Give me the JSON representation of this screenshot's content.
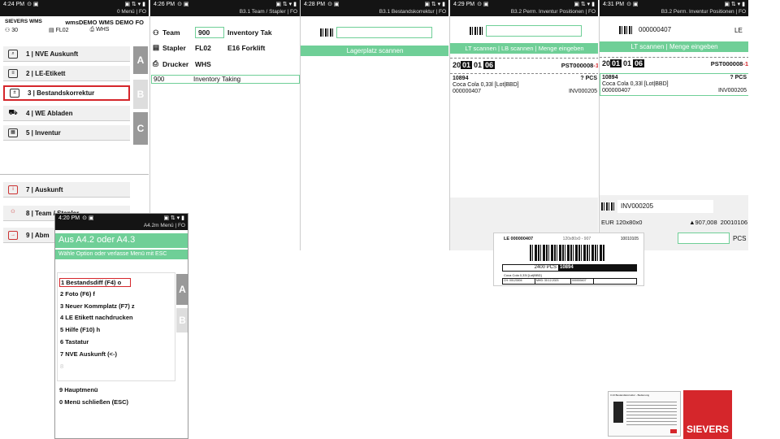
{
  "screens": {
    "main": {
      "time": "4:24 PM",
      "header": "0 Menü | FO",
      "brand": "SIEVERS WMS",
      "title": "wmsDEMO WMS DEMO FO",
      "team": "30",
      "stapler": "FL02",
      "printer": "WHS",
      "items": [
        {
          "icon": "doc-search-icon",
          "label": "1 | NVE Auskunft"
        },
        {
          "icon": "tag-icon",
          "label": "2 | LE-Etikett"
        },
        {
          "icon": "edit-list-icon",
          "label": "3 | Bestandskorrektur"
        },
        {
          "icon": "truck-icon",
          "label": "4 | WE Abladen"
        },
        {
          "icon": "grid-icon",
          "label": "5 | Inventur"
        }
      ],
      "items2": [
        {
          "icon": "info-icon",
          "label": "7 | Auskunft"
        },
        {
          "icon": "people-icon",
          "label": "8 | Team / Stapler"
        },
        {
          "icon": "logout-icon",
          "label": "9 | Abm"
        }
      ],
      "tabs": [
        "A",
        "B",
        "C"
      ]
    },
    "team": {
      "time": "4:26 PM",
      "header": "B3.1 Team / Stapler | FO",
      "team_label": "Team",
      "team_val": "900",
      "team_name": "Inventory Tak",
      "stapler_label": "Stapler",
      "stapler_val": "FL02",
      "stapler_name": "E16 Forklift",
      "drucker_label": "Drucker",
      "drucker_val": "WHS",
      "row_id": "900",
      "row_name": "Inventory Taking"
    },
    "scan": {
      "time": "4:28 PM",
      "header": "B3.1 Bestandskorrektur | FO",
      "hint": "Lagerplatz scannen"
    },
    "pos1": {
      "time": "4:29 PM",
      "header": "B3.2 Perm. Inventur Positionen | FO",
      "hint": "LT scannen | LB scannen | Menge eingeben",
      "loc": [
        "20",
        "01",
        "01",
        "06"
      ],
      "pst": "PST000008",
      "pst_suffix": "-1",
      "article": "10894",
      "qty": "? PCS",
      "desc": "Coca Cola 0,33l [Lot|BBD]",
      "lt": "000000407",
      "inv": "INV000205"
    },
    "pos2": {
      "time": "4:31 PM",
      "header": "B3.2 Perm. Inventur Positionen | FO",
      "scan_val": "000000407",
      "scan_suffix": "LE",
      "hint": "LT scannen | Menge eingeben",
      "loc": [
        "20",
        "01",
        "01",
        "06"
      ],
      "pst": "PST000008",
      "pst_suffix": "-1",
      "article": "10894",
      "qty": "? PCS",
      "desc": "Coca Cola 0,33l [Lot|BBD]",
      "lt": "000000407",
      "inv": "INV000205",
      "inv_field": "INV000205",
      "pallet": "EUR 120x80x0",
      "weight": "907,008",
      "date": "20010106",
      "unit": "PCS"
    },
    "popup": {
      "time": "4:20 PM",
      "header": "A4.2m Menü | FO",
      "title": "Aus A4.2 oder A4.3",
      "subtitle": "Wähle Option oder verlasse Menü mit ESC",
      "options": [
        "1 Bestandsdiff (F4) o",
        "2 Foto (F6) f",
        "3 Neuer Kommplatz (F7) z",
        "4 LE Etikett nachdrucken",
        "5 Hilfe (F10) h",
        "6 Tastatur",
        "7 NVE Auskunft (<-)",
        "8"
      ],
      "footer": [
        "9 Hauptmenü",
        "0 Menü schließen (ESC)"
      ],
      "tabs": [
        "A",
        "B"
      ]
    }
  },
  "label": {
    "le": "LE 000000407",
    "dims": "120x80x0 - 907",
    "code": "10010105",
    "qty": "2400 PCS",
    "art": "10894",
    "desc": "Coca Cola 0,33l [Lot|BBD]",
    "f1": "CH: 00123004",
    "f2": "MHD: 30.12.2023",
    "f3": "000000407"
  },
  "brand": {
    "name": "SIEVERS",
    "color": "#d5262b",
    "thumb_title": "3.13 Bestandskorrektur - Bedienung"
  },
  "colors": {
    "green": "#6fcf97",
    "highlight": "#d5262b",
    "dark": "#141414"
  }
}
